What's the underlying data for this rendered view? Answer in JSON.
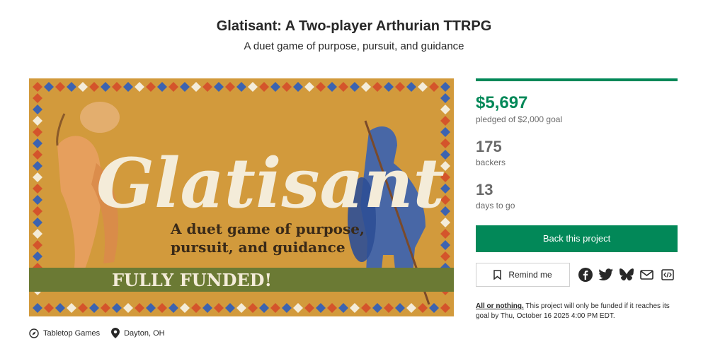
{
  "project": {
    "title": "Glatisant: A Two-player Arthurian TTRPG",
    "subtitle": "A duet game of purpose, pursuit, and guidance"
  },
  "hero": {
    "logo_text": "Glatisant",
    "tagline_line1": "A duet game of purpose,",
    "tagline_line2": "pursuit, and guidance",
    "banner": "FULLY FUNDED!",
    "colors": {
      "background": "#d29a3c",
      "banner": "#6b7a34",
      "diamond_red": "#d4542b",
      "diamond_blue": "#3c63b0",
      "cream": "#f4ecd9"
    }
  },
  "meta": {
    "category": {
      "icon": "compass-icon",
      "label": "Tabletop Games"
    },
    "location": {
      "icon": "map-pin-icon",
      "label": "Dayton, OH"
    }
  },
  "stats": {
    "pledged": "$5,697",
    "pledged_sub": "pledged of $2,000 goal",
    "progress_percent": 100,
    "backers": "175",
    "backers_label": "backers",
    "days": "13",
    "days_label": "days to go"
  },
  "actions": {
    "back_label": "Back this project",
    "remind_label": "Remind me",
    "share_icons": [
      "facebook-icon",
      "twitter-icon",
      "bluesky-icon",
      "email-icon",
      "embed-icon"
    ]
  },
  "fine_print": {
    "link": "All or nothing.",
    "text": " This project will only be funded if it reaches its goal by Thu, October 16 2025 4:00 PM EDT."
  },
  "accent_color": "#028858"
}
